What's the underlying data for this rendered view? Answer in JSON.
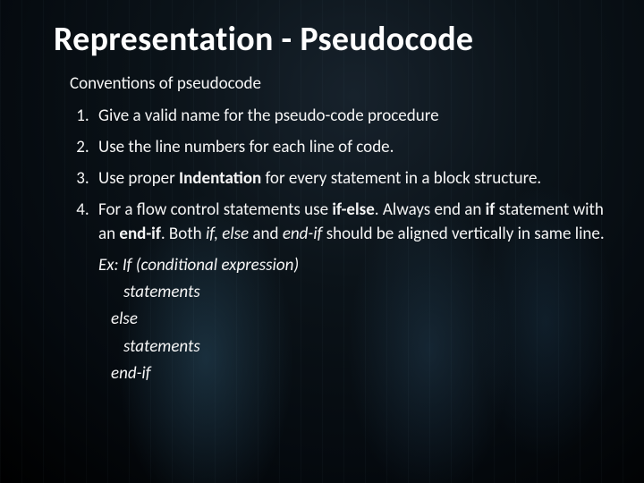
{
  "title": "Representation - Pseudocode",
  "subtitle": "Conventions of pseudocode",
  "items": {
    "one": "Give a valid name for the pseudo-code procedure",
    "two": "Use the line numbers for each line of code.",
    "three_a": "Use proper ",
    "three_b": "Indentation",
    "three_c": " for every statement in a block structure.",
    "four_a": "For a flow control statements use ",
    "four_b": "if-else",
    "four_c": ". Always end an ",
    "four_d": "if",
    "four_e": " statement with an ",
    "four_f": "end-if",
    "four_g": ". Both ",
    "four_h": "if, else",
    "four_i": " and ",
    "four_j": "end-if",
    "four_k": " should be aligned vertically in same line."
  },
  "example": {
    "l1_a": "Ex: If ",
    "l1_b": "(conditional expression)",
    "l2": "statements",
    "l3": "else",
    "l4": "statements",
    "l5": "end-if"
  }
}
